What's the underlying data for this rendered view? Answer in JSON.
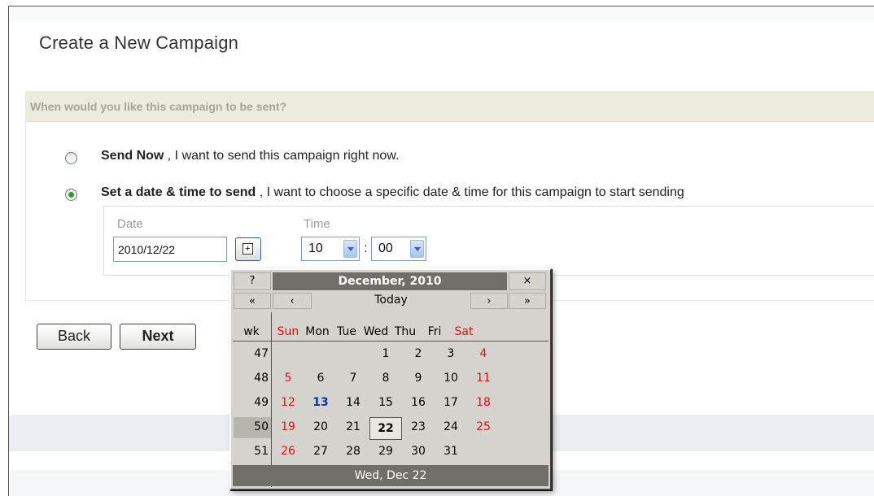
{
  "page": {
    "title": "Create a New Campaign"
  },
  "schedule": {
    "question": "When would you like this campaign to be sent?",
    "options": [
      {
        "bold": "Send Now",
        "rest": " , I want to send this campaign right now.",
        "selected": false
      },
      {
        "bold": "Set a date & time to send",
        "rest": " , I want to choose a specific date & time for this campaign to start sending",
        "selected": true
      }
    ],
    "date_label": "Date",
    "date_value": "2010/12/22",
    "calendar_button_glyph": "+",
    "time_label": "Time",
    "hour_value": "10",
    "minute_value": "00",
    "time_separator": ":"
  },
  "buttons": {
    "back": "Back",
    "next": "Next"
  },
  "calendar": {
    "help": "?",
    "title": "December, 2010",
    "close": "×",
    "prev_year": "«",
    "prev_month": "‹",
    "today": "Today",
    "next_month": "›",
    "next_year": "»",
    "wk_header": "wk",
    "day_names": [
      "Sun",
      "Mon",
      "Tue",
      "Wed",
      "Thu",
      "Fri",
      "Sat"
    ],
    "weeks": [
      {
        "wk": "47",
        "days": [
          "",
          "",
          "",
          "1",
          "2",
          "3",
          "4"
        ]
      },
      {
        "wk": "48",
        "days": [
          "5",
          "6",
          "7",
          "8",
          "9",
          "10",
          "11"
        ]
      },
      {
        "wk": "49",
        "days": [
          "12",
          "13",
          "14",
          "15",
          "16",
          "17",
          "18"
        ]
      },
      {
        "wk": "50",
        "days": [
          "19",
          "20",
          "21",
          "22",
          "23",
          "24",
          "25"
        ]
      },
      {
        "wk": "51",
        "days": [
          "26",
          "27",
          "28",
          "29",
          "30",
          "31",
          ""
        ]
      }
    ],
    "today_date": "13",
    "selected_date": "22",
    "footer": "Wed, Dec 22",
    "colors": {
      "weekend": "#d11111",
      "today": "#1133aa",
      "header": "#6f6e68"
    }
  },
  "icons": {
    "calendar_button": "calendar-icon",
    "select_arrow": "chevron-down-icon"
  }
}
